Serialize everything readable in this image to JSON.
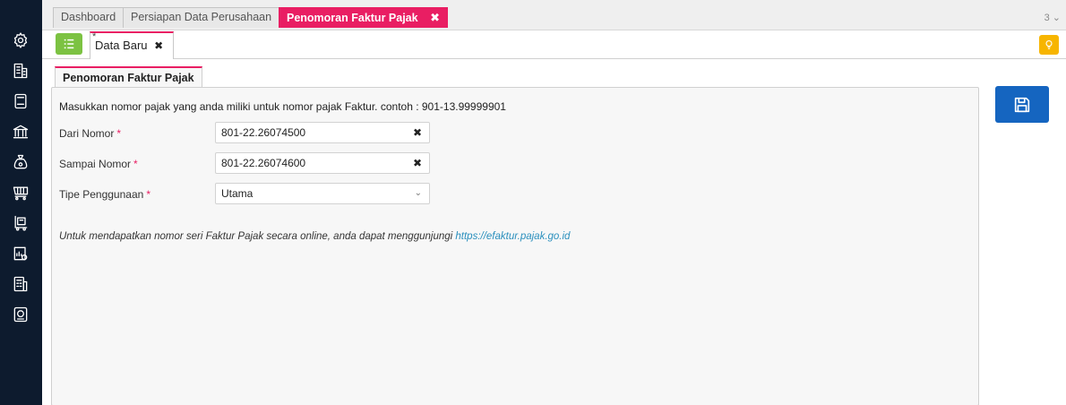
{
  "sidebar": {
    "icons": [
      "settings-icon",
      "company-icon",
      "clipboard-icon",
      "bank-icon",
      "money-bag-icon",
      "cart-icon",
      "delivery-icon",
      "report-icon",
      "calculator-icon",
      "invoice-icon"
    ]
  },
  "tabs": {
    "items": [
      "Dashboard",
      "Persiapan Data Perusahaan",
      "Penomoran Faktur Pajak"
    ],
    "active_index": 2,
    "close_glyph": "✖",
    "overflow_label": "3 ⌄"
  },
  "toolbar": {
    "doc_tab_marker": "*",
    "doc_tab_label": "Data Baru",
    "doc_tab_close": "✖"
  },
  "section": {
    "tab_label": "Penomoran Faktur Pajak"
  },
  "form": {
    "instruction": "Masukkan nomor pajak yang anda miliki untuk nomor pajak Faktur. contoh : 901-13.99999901",
    "required_marker": "*",
    "dari_nomor": {
      "label": "Dari Nomor",
      "value": "801-22.26074500"
    },
    "sampai_nomor": {
      "label": "Sampai Nomor",
      "value": "801-22.26074600"
    },
    "tipe_penggunaan": {
      "label": "Tipe Penggunaan",
      "value": "Utama"
    },
    "clear_glyph": "✖",
    "dropdown_glyph": "⌄"
  },
  "note": {
    "text": "Untuk mendapatkan nomor seri Faktur Pajak secara online, anda dapat menggunjungi ",
    "link": "https://efaktur.pajak.go.id"
  },
  "colors": {
    "sidebar_bg": "#0d1b2e",
    "accent": "#e91e63",
    "save_button": "#1565c0",
    "list_button": "#7cc242",
    "hint_button": "#f7b500",
    "link": "#2a8fbd"
  }
}
